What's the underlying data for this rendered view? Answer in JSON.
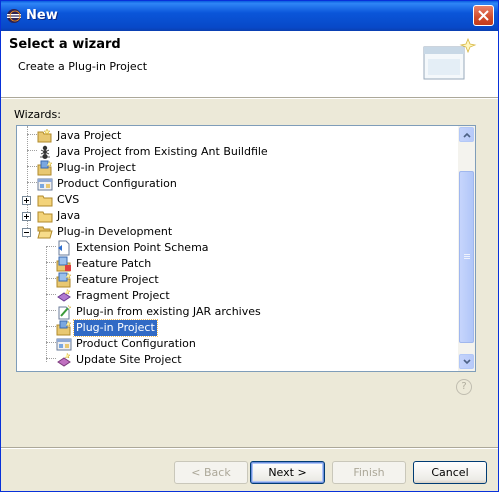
{
  "window": {
    "title": "New",
    "close_icon": "close-icon"
  },
  "header": {
    "title": "Select a wizard",
    "subtitle": "Create a Plug-in Project"
  },
  "wizards_label": "Wizards:",
  "tree": {
    "items": [
      {
        "label": "Java Project",
        "icon": "java-project-icon",
        "level": 1
      },
      {
        "label": "Java Project from Existing Ant Buildfile",
        "icon": "ant-icon",
        "level": 1
      },
      {
        "label": "Plug-in Project",
        "icon": "plugin-project-icon",
        "level": 1
      },
      {
        "label": "Product Configuration",
        "icon": "product-config-icon",
        "level": 1
      },
      {
        "label": "CVS",
        "icon": "folder-icon",
        "level": 0,
        "expanded": false
      },
      {
        "label": "Java",
        "icon": "folder-icon",
        "level": 0,
        "expanded": false
      },
      {
        "label": "Plug-in Development",
        "icon": "folder-open-icon",
        "level": 0,
        "expanded": true
      },
      {
        "label": "Extension Point Schema",
        "icon": "schema-icon",
        "level": 2
      },
      {
        "label": "Feature Patch",
        "icon": "feature-patch-icon",
        "level": 2
      },
      {
        "label": "Feature Project",
        "icon": "feature-project-icon",
        "level": 2
      },
      {
        "label": "Fragment Project",
        "icon": "fragment-project-icon",
        "level": 2
      },
      {
        "label": "Plug-in from existing JAR archives",
        "icon": "plugin-jar-icon",
        "level": 2
      },
      {
        "label": "Plug-in Project",
        "icon": "plugin-project-icon",
        "level": 2,
        "selected": true
      },
      {
        "label": "Product Configuration",
        "icon": "product-config-icon",
        "level": 2
      },
      {
        "label": "Update Site Project",
        "icon": "update-site-icon",
        "level": 2
      }
    ]
  },
  "buttons": {
    "back": "< Back",
    "next": "Next >",
    "finish": "Finish",
    "cancel": "Cancel"
  },
  "help_icon": "help-icon",
  "colors": {
    "titlebar": "#0a56d9",
    "selection": "#316ac5",
    "dialog_bg": "#ece9d8"
  }
}
